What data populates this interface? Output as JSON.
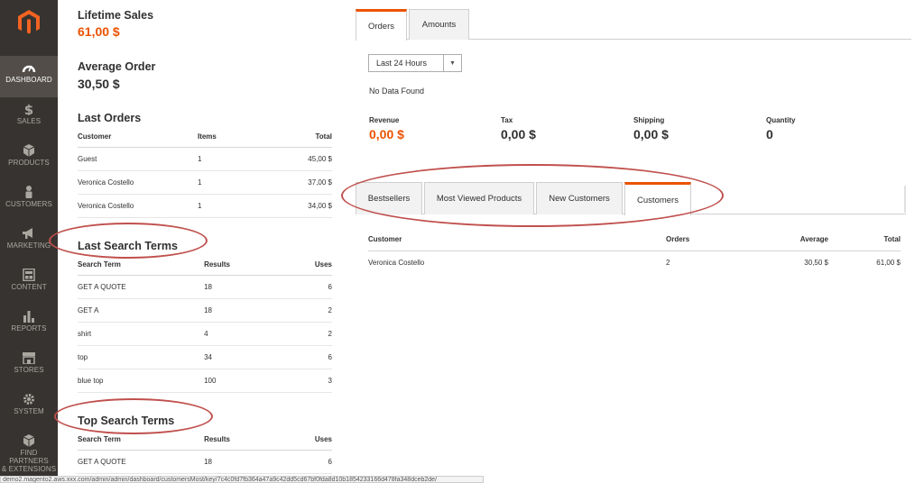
{
  "sidebar": {
    "items": [
      {
        "label": "DASHBOARD",
        "icon": "dashboard-icon"
      },
      {
        "label": "SALES",
        "icon": "dollar-icon"
      },
      {
        "label": "PRODUCTS",
        "icon": "cube-icon"
      },
      {
        "label": "CUSTOMERS",
        "icon": "person-icon"
      },
      {
        "label": "MARKETING",
        "icon": "megaphone-icon"
      },
      {
        "label": "CONTENT",
        "icon": "layout-icon"
      },
      {
        "label": "REPORTS",
        "icon": "bar-chart-icon"
      },
      {
        "label": "STORES",
        "icon": "store-icon"
      },
      {
        "label": "SYSTEM",
        "icon": "gear-icon"
      },
      {
        "label_line1": "FIND PARTNERS",
        "label_line2": "& EXTENSIONS",
        "icon": "box-icon"
      }
    ]
  },
  "stats": {
    "lifetime_sales_label": "Lifetime Sales",
    "lifetime_sales_value": "61,00 $",
    "average_order_label": "Average Order",
    "average_order_value": "30,50 $"
  },
  "last_orders": {
    "title": "Last Orders",
    "headers": [
      "Customer",
      "Items",
      "Total"
    ],
    "rows": [
      [
        "Guest",
        "1",
        "45,00 $"
      ],
      [
        "Veronica Costello",
        "1",
        "37,00 $"
      ],
      [
        "Veronica Costello",
        "1",
        "34,00 $"
      ]
    ]
  },
  "last_search_terms": {
    "title": "Last Search Terms",
    "headers": [
      "Search Term",
      "Results",
      "Uses"
    ],
    "rows": [
      [
        "GET A QUOTE",
        "18",
        "6"
      ],
      [
        "GET A",
        "18",
        "2"
      ],
      [
        "shirt",
        "4",
        "2"
      ],
      [
        "top",
        "34",
        "6"
      ],
      [
        "blue top",
        "100",
        "3"
      ]
    ]
  },
  "top_search_terms": {
    "title": "Top Search Terms",
    "headers": [
      "Search Term",
      "Results",
      "Uses"
    ],
    "rows": [
      [
        "GET A QUOTE",
        "18",
        "6"
      ]
    ]
  },
  "chart_tabs": [
    "Orders",
    "Amounts"
  ],
  "period_select": "Last 24 Hours",
  "no_data": "No Data Found",
  "metrics": [
    {
      "label": "Revenue",
      "value": "0,00 $"
    },
    {
      "label": "Tax",
      "value": "0,00 $"
    },
    {
      "label": "Shipping",
      "value": "0,00 $"
    },
    {
      "label": "Quantity",
      "value": "0"
    }
  ],
  "grid_tabs": [
    "Bestsellers",
    "Most Viewed Products",
    "New Customers",
    "Customers"
  ],
  "customers_table": {
    "headers": [
      "Customer",
      "Orders",
      "Average",
      "Total"
    ],
    "rows": [
      [
        "Veronica Costello",
        "2",
        "30,50 $",
        "61,00 $"
      ]
    ]
  },
  "status_url": "demo2.magento2.aws.xxx.com/admin/admin/dashboard/customersMost/key/7c4c0fd7fb364a47a9c42dd5cd67bf0fda8d10b1854233166d478fa348dceb2de/",
  "colors": {
    "accent": "#eb5202",
    "sidebar": "#373330",
    "annotation": "#c0504d"
  }
}
